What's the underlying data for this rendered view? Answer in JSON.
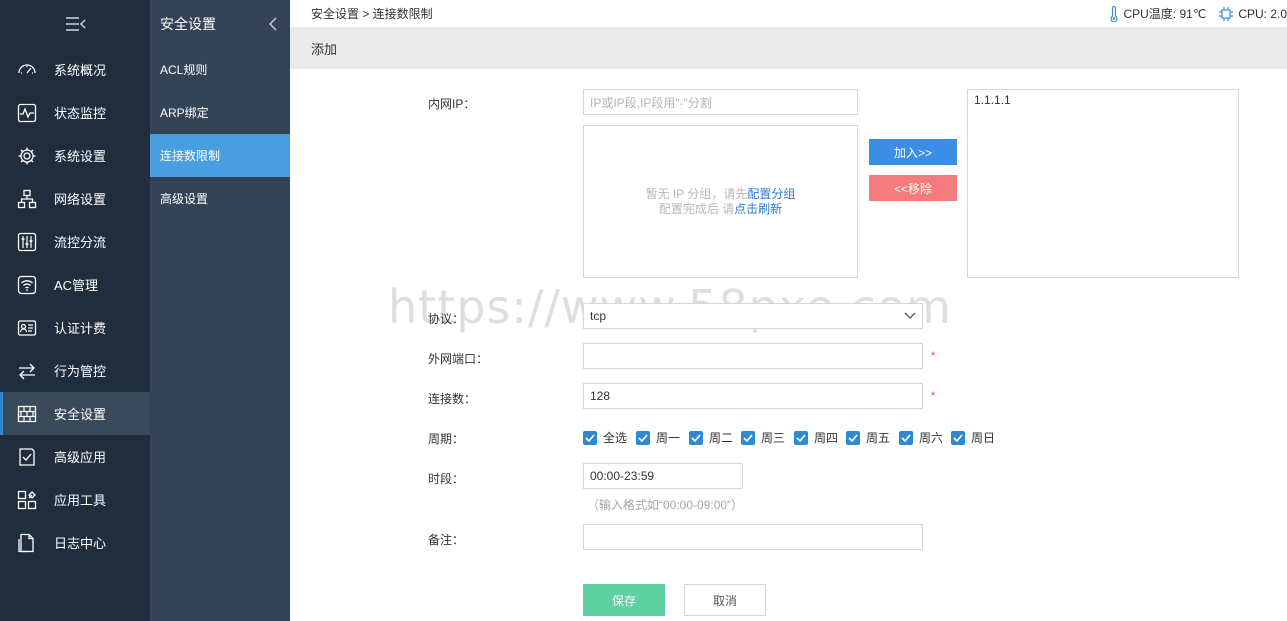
{
  "sidebar": {
    "items": [
      {
        "label": "系统概况",
        "icon": "dashboard-icon"
      },
      {
        "label": "状态监控",
        "icon": "pulse-icon"
      },
      {
        "label": "系统设置",
        "icon": "gear-icon"
      },
      {
        "label": "网络设置",
        "icon": "network-icon"
      },
      {
        "label": "流控分流",
        "icon": "sliders-icon"
      },
      {
        "label": "AC管理",
        "icon": "wifi-icon"
      },
      {
        "label": "认证计费",
        "icon": "id-card-icon"
      },
      {
        "label": "行为管控",
        "icon": "swap-arrows-icon"
      },
      {
        "label": "安全设置",
        "icon": "firewall-icon"
      },
      {
        "label": "高级应用",
        "icon": "checklist-icon"
      },
      {
        "label": "应用工具",
        "icon": "tools-icon"
      },
      {
        "label": "日志中心",
        "icon": "document-icon"
      }
    ],
    "active_index": 8
  },
  "submenu": {
    "title": "安全设置",
    "items": [
      "ACL规则",
      "ARP绑定",
      "连接数限制",
      "高级设置"
    ],
    "active_index": 2
  },
  "topbar": {
    "breadcrumb": "安全设置 > 连接数限制",
    "cpu_temp": "CPU温度: 91℃",
    "cpu": "CPU: 2.0"
  },
  "page": {
    "title": "添加"
  },
  "form": {
    "lan_ip_label": "内网IP：",
    "lan_ip_placeholder": "IP或IP段,IP段用\"-\"分割",
    "group_empty_1": "暂无 IP 分组，请先",
    "group_empty_link1": "配置分组",
    "group_empty_2": "配置完成后 请",
    "group_empty_link2": "点击刷新",
    "add_btn": "加入>>",
    "remove_btn": "<<移除",
    "selected_ips": [
      "1.1.1.1"
    ],
    "protocol_label": "协议：",
    "protocol_value": "tcp",
    "wan_port_label": "外网端口：",
    "wan_port_value": "",
    "conn_label": "连接数：",
    "conn_value": "128",
    "required_mark": "*",
    "period_label": "周期：",
    "days": [
      "全选",
      "周一",
      "周二",
      "周三",
      "周四",
      "周五",
      "周六",
      "周日"
    ],
    "time_label": "时段：",
    "time_value": "00:00-23:59",
    "time_hint": "（输入格式如“00:00-09:00”）",
    "remark_label": "备注：",
    "remark_value": "",
    "save_btn": "保存",
    "cancel_btn": "取消"
  },
  "watermark": "https://www.58pxe.com",
  "colors": {
    "sidebar_bg": "#1f2d3d",
    "submenu_bg": "#344356",
    "accent": "#4a9ee0",
    "add_btn": "#3a8ee6",
    "remove_btn": "#f37b7c",
    "save_btn": "#5ed0a2",
    "link": "#2f7ad3"
  }
}
